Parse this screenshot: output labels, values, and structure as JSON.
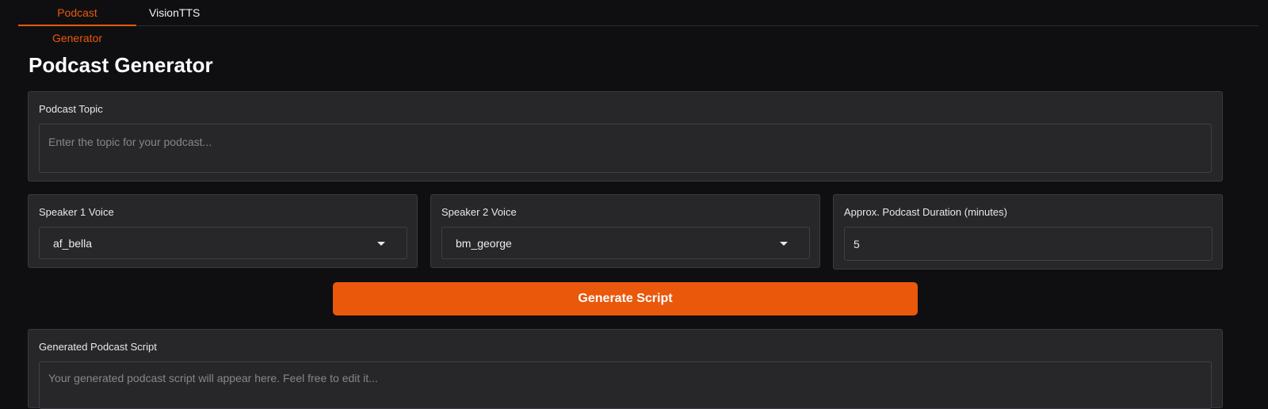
{
  "tabs": [
    {
      "label": "Podcast Generator",
      "active": true
    },
    {
      "label": "VisionTTS",
      "active": false
    }
  ],
  "page": {
    "title": "Podcast Generator"
  },
  "topic": {
    "label": "Podcast Topic",
    "placeholder": "Enter the topic for your podcast...",
    "value": ""
  },
  "speaker1": {
    "label": "Speaker 1 Voice",
    "value": "af_bella",
    "icon": "chevron-down-icon"
  },
  "speaker2": {
    "label": "Speaker 2 Voice",
    "value": "bm_george",
    "icon": "chevron-down-icon"
  },
  "duration": {
    "label": "Approx. Podcast Duration (minutes)",
    "value": "5"
  },
  "generate": {
    "label": "Generate Script"
  },
  "script": {
    "label": "Generated Podcast Script",
    "placeholder": "Your generated podcast script will appear here. Feel free to edit it...",
    "value": ""
  },
  "colors": {
    "accent": "#ea580c",
    "background": "#0f0f11",
    "panel": "#27272a"
  }
}
